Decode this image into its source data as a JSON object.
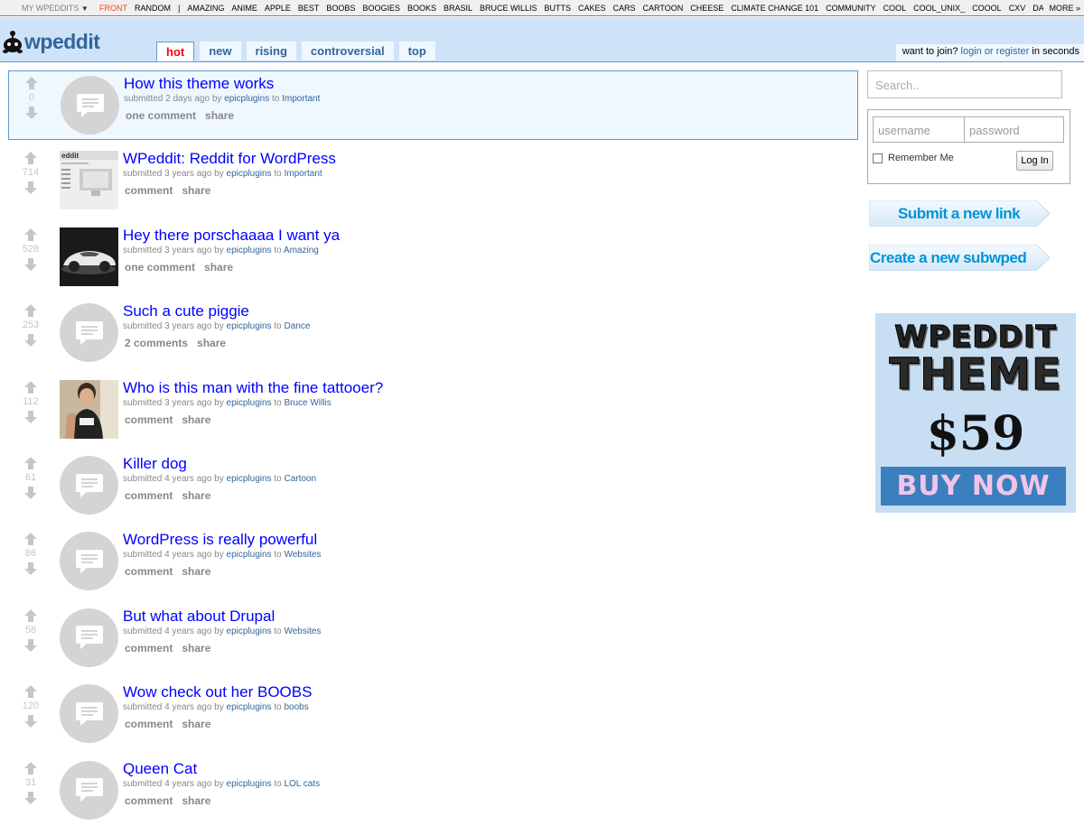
{
  "srbar": {
    "my_subreddits": "MY WPEDDITS",
    "items": [
      "FRONT",
      "RANDOM",
      "|",
      "AMAZING",
      "ANIME",
      "APPLE",
      "BEST",
      "BOOBS",
      "BOOGIES",
      "BOOKS",
      "BRASIL",
      "BRUCE WILLIS",
      "BUTTS",
      "CAKES",
      "CARS",
      "CARTOON",
      "CHEESE",
      "CLIMATE CHANGE 101",
      "COMMUNITY",
      "COOL",
      "COOL_UNIX_",
      "COOOL",
      "CXV",
      "DANCE"
    ],
    "more": "MORE »"
  },
  "header": {
    "logo_text": "wpeddit",
    "tabs": [
      "hot",
      "new",
      "rising",
      "controversial",
      "top"
    ],
    "selected_tab": "hot",
    "join_prefix": "want to join?",
    "login_link": "login or register",
    "join_suffix": "in seconds"
  },
  "posts": [
    {
      "title": "How this theme works",
      "score": "0",
      "submitted": "submitted 2 days ago by",
      "author": "epicplugins",
      "to": "to",
      "subreddit": "Important",
      "comments": "one comment",
      "share": "share",
      "thumb": "default"
    },
    {
      "title": "WPeddit: Reddit for WordPress",
      "score": "714",
      "submitted": "submitted 3 years ago by",
      "author": "epicplugins",
      "to": "to",
      "subreddit": "Important",
      "comments": "comment",
      "share": "share",
      "thumb": "screenshot"
    },
    {
      "title": "Hey there porschaaaa I want ya",
      "score": "528",
      "submitted": "submitted 3 years ago by",
      "author": "epicplugins",
      "to": "to",
      "subreddit": "Amazing",
      "comments": "one comment",
      "share": "share",
      "thumb": "car"
    },
    {
      "title": "Such a cute piggie",
      "score": "253",
      "submitted": "submitted 3 years ago by",
      "author": "epicplugins",
      "to": "to",
      "subreddit": "Dance",
      "comments": "2 comments",
      "share": "share",
      "thumb": "default"
    },
    {
      "title": "Who is this man with the fine tattooer?",
      "score": "112",
      "submitted": "submitted 3 years ago by",
      "author": "epicplugins",
      "to": "to",
      "subreddit": "Bruce Willis",
      "comments": "comment",
      "share": "share",
      "thumb": "person"
    },
    {
      "title": "Killer dog",
      "score": "61",
      "submitted": "submitted 4 years ago by",
      "author": "epicplugins",
      "to": "to",
      "subreddit": "Cartoon",
      "comments": "comment",
      "share": "share",
      "thumb": "default"
    },
    {
      "title": "WordPress is really powerful",
      "score": "86",
      "submitted": "submitted 4 years ago by",
      "author": "epicplugins",
      "to": "to",
      "subreddit": "Websites",
      "comments": "comment",
      "share": "share",
      "thumb": "default"
    },
    {
      "title": "But what about Drupal",
      "score": "58",
      "submitted": "submitted 4 years ago by",
      "author": "epicplugins",
      "to": "to",
      "subreddit": "Websites",
      "comments": "comment",
      "share": "share",
      "thumb": "default"
    },
    {
      "title": "Wow check out her BOOBS",
      "score": "120",
      "submitted": "submitted 4 years ago by",
      "author": "epicplugins",
      "to": "to",
      "subreddit": "boobs",
      "comments": "comment",
      "share": "share",
      "thumb": "default"
    },
    {
      "title": "Queen Cat",
      "score": "31",
      "submitted": "submitted 4 years ago by",
      "author": "epicplugins",
      "to": "to",
      "subreddit": "LOL cats",
      "comments": "comment",
      "share": "share",
      "thumb": "default"
    }
  ],
  "sidebar": {
    "search_placeholder": "Search..",
    "username_placeholder": "username",
    "password_placeholder": "password",
    "remember_label": "Remember Me",
    "login_button": "Log In",
    "submit_link": "Submit a new link",
    "create_subwped": "Create a new subwped"
  },
  "ad": {
    "line1": "WPEDDIT",
    "line2": "THEME",
    "price": "$59",
    "cta": "BUY NOW"
  },
  "colors": {
    "header_bg": "#cee3f8",
    "link_blue": "#0000ff",
    "accent": "#369",
    "selected_tab": "#ff0000",
    "sidebar_button": "#0094d6"
  }
}
